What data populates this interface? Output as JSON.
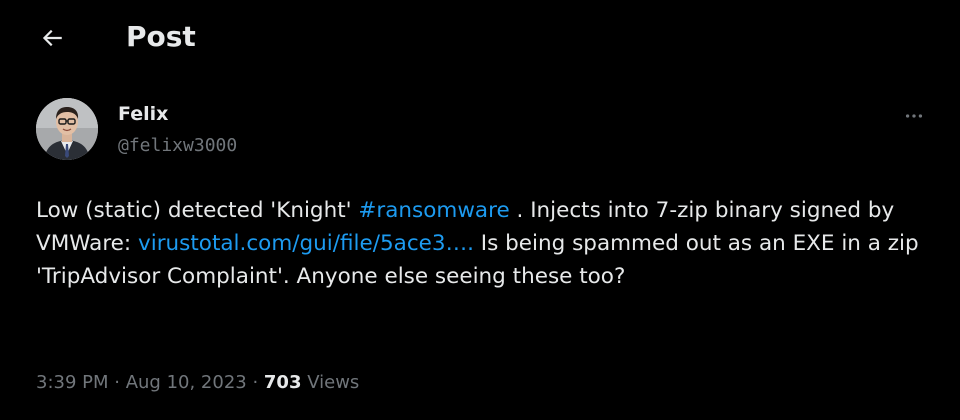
{
  "header": {
    "title": "Post",
    "back_icon": "arrow-left-icon"
  },
  "author": {
    "name": "Felix",
    "handle": "@felixw3000",
    "more_icon": "more-horizontal-icon"
  },
  "post": {
    "text_part1": "Low (static) detected 'Knight' ",
    "hashtag": "#ransomware",
    "text_part2": " . Injects into 7-zip binary signed by VMWare: ",
    "link": "virustotal.com/gui/file/5ace3….",
    "text_part3": " Is being spammed out as an EXE in a zip 'TripAdvisor Complaint'. Anyone else seeing these too?"
  },
  "meta": {
    "time": "3:39 PM",
    "separator": " · ",
    "date": "Aug 10, 2023",
    "views_count": "703",
    "views_label": " Views"
  },
  "colors": {
    "background": "#000000",
    "text": "#e7e9ea",
    "secondary": "#71767b",
    "link": "#1d9bf0"
  }
}
